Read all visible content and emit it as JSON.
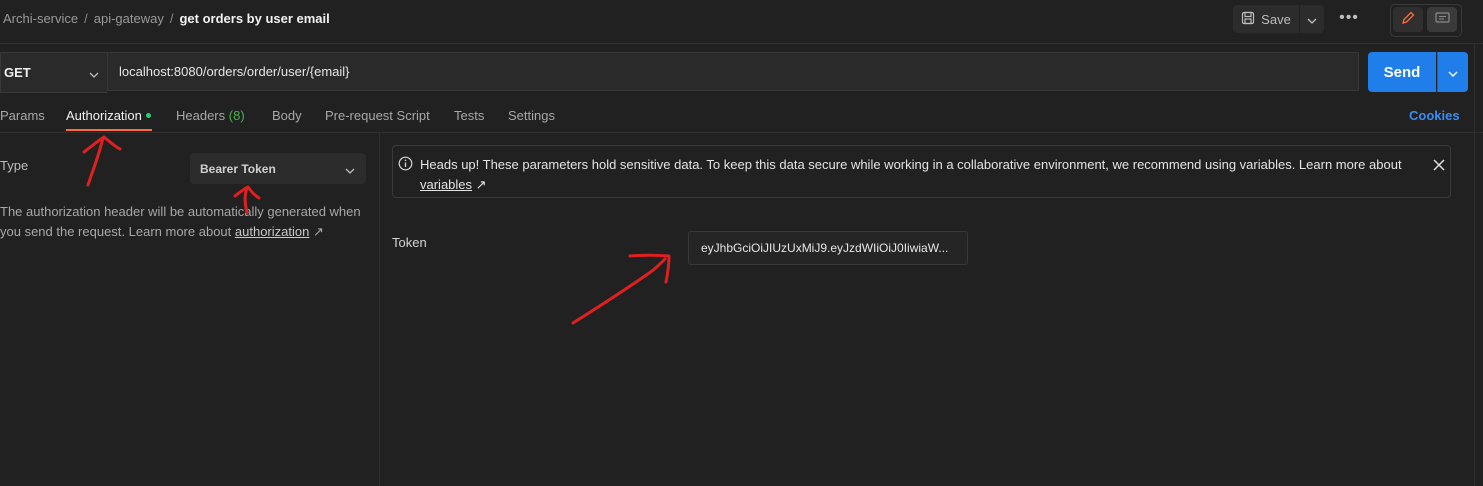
{
  "breadcrumb": {
    "collection": "Archi-service",
    "folder": "api-gateway",
    "separator": "/",
    "request": "get orders by user email"
  },
  "header": {
    "save_label": "Save",
    "more_label": "•••"
  },
  "request": {
    "method": "GET",
    "url": "localhost:8080/orders/order/user/{email}",
    "send_label": "Send"
  },
  "tabs": [
    {
      "label": "Params",
      "active": false
    },
    {
      "label": "Authorization",
      "active": true
    },
    {
      "label": "Headers",
      "count": "(8)",
      "active": false
    },
    {
      "label": "Body",
      "active": false
    },
    {
      "label": "Pre-request Script",
      "active": false
    },
    {
      "label": "Tests",
      "active": false
    },
    {
      "label": "Settings",
      "active": false
    }
  ],
  "cookies_label": "Cookies",
  "auth": {
    "type_label": "Type",
    "type_value": "Bearer Token",
    "description": "The authorization header will be automatically generated when you send the request. Learn more about ",
    "description_link": "authorization",
    "link_arrow": "↗"
  },
  "notice": {
    "text": "Heads up! These parameters hold sensitive data. To keep this data secure while working in a collaborative environment, we recommend using variables. Learn more about ",
    "link": "variables",
    "link_arrow": "↗"
  },
  "token": {
    "label": "Token",
    "value": "eyJhbGciOiJIUzUxMiJ9.eyJzdWIiOiJ0IiwiaW..."
  },
  "colors": {
    "background": "#212121",
    "accent_orange": "#ff6c37",
    "send_blue": "#1f7eea",
    "link_blue": "#3b8cf0",
    "annotation_red": "#e02020"
  },
  "icons": [
    "save-icon",
    "chevron-down-icon",
    "more-icon",
    "pencil-icon",
    "comment-icon",
    "info-icon",
    "close-icon",
    "external-link-icon"
  ]
}
